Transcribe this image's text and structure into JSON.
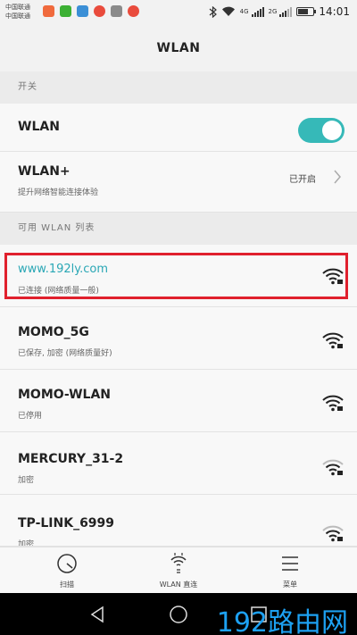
{
  "status_bar": {
    "carrier_1": "中国联通",
    "carrier_2": "中国联通",
    "network_1": "4G",
    "network_2": "2G",
    "time": "14:01",
    "battery_level": 0.7
  },
  "title": "WLAN",
  "switch_section": {
    "header": "开关",
    "wlan_label": "WLAN",
    "wlan_enabled": true,
    "wlan_plus_label": "WLAN+",
    "wlan_plus_desc": "提升网络智能连接体验",
    "wlan_plus_value": "已开启"
  },
  "network_section": {
    "header": "可用 WLAN 列表",
    "networks": [
      {
        "ssid": "www.192ly.com",
        "status": "已连接 (网络质量一般)",
        "connected": true
      },
      {
        "ssid": "MOMO_5G",
        "status": "已保存, 加密 (网络质量好)",
        "connected": false
      },
      {
        "ssid": "MOMO-WLAN",
        "status": "已停用",
        "connected": false
      },
      {
        "ssid": "MERCURY_31-2",
        "status": "加密",
        "connected": false
      },
      {
        "ssid": "TP-LINK_6999",
        "status": "加密",
        "connected": false
      }
    ]
  },
  "toolbar": {
    "scan": "扫描",
    "direct": "WLAN 直连",
    "menu": "菜单"
  },
  "watermark": "192路由网",
  "colors": {
    "accent": "#36b9b8",
    "connected_text": "#2aa7b5",
    "highlight_border": "#e0202d",
    "watermark": "#1da1f2"
  }
}
